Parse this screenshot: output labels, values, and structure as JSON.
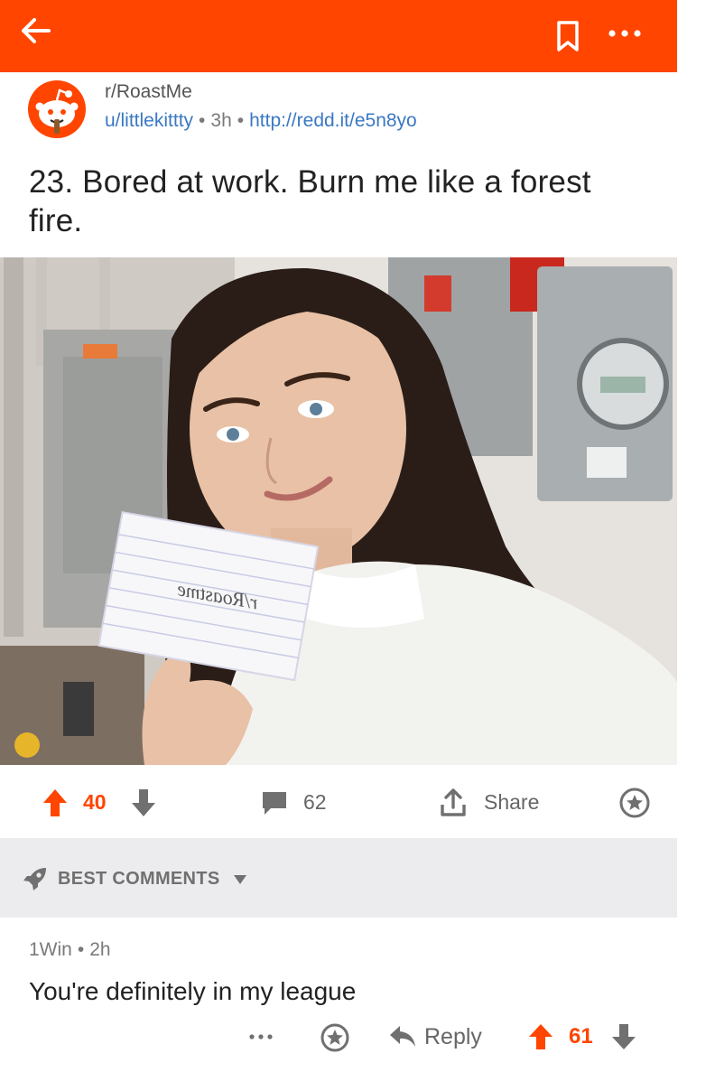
{
  "colors": {
    "brand": "#ff4500",
    "link": "#3a78c4",
    "muted": "#7a7a7a",
    "sort_bg": "#ececee"
  },
  "topbar": {
    "back_icon": "arrow-left-icon",
    "bookmark_icon": "bookmark-icon",
    "more_icon": "more-icon"
  },
  "post": {
    "subreddit": "r/RoastMe",
    "author": "u/littlekittty",
    "age": "3h",
    "url": "http://redd.it/e5n8yo",
    "title": "23. Bored at work. Burn me like a forest fire.",
    "sign_text": "r/Roastme"
  },
  "actions": {
    "score": "40",
    "comments": "62",
    "share_label": "Share"
  },
  "sort": {
    "label": "BEST COMMENTS"
  },
  "comment": {
    "author": "1Win",
    "age": "2h",
    "body": "You're definitely in my league",
    "reply_label": "Reply",
    "score": "61"
  }
}
